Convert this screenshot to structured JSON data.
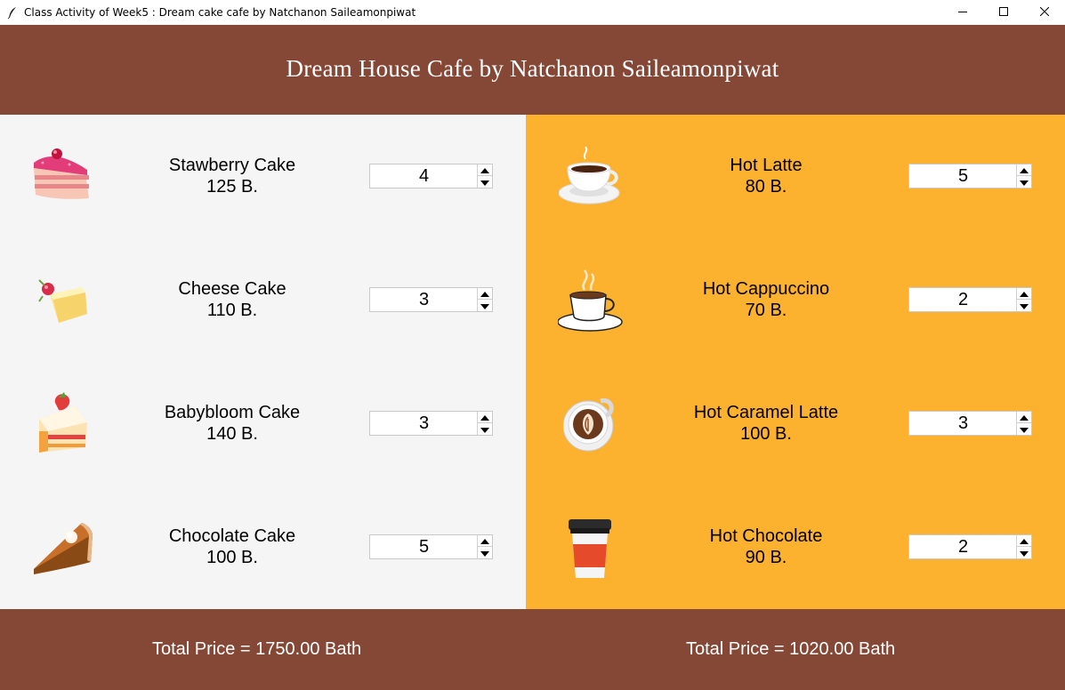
{
  "window": {
    "title": "Class Activity of Week5 : Dream cake cafe by Natchanon Saileamonpiwat",
    "icon": "feather-icon",
    "controls": [
      "minimize-icon",
      "maximize-icon",
      "close-icon"
    ]
  },
  "header": {
    "title": "Dream House Cafe by Natchanon Saileamonpiwat"
  },
  "colors": {
    "header_bg": "#864836",
    "left_panel_bg": "#f5f5f5",
    "right_panel_bg": "#fdb22f",
    "footer_bg": "#864836"
  },
  "cakes": [
    {
      "name": "Stawberry Cake",
      "price": "125 B.",
      "qty": "4",
      "icon": "strawberry-cake-icon"
    },
    {
      "name": "Cheese Cake",
      "price": "110 B.",
      "qty": "3",
      "icon": "cheese-cake-icon"
    },
    {
      "name": "Babybloom Cake",
      "price": "140 B.",
      "qty": "3",
      "icon": "babybloom-cake-icon"
    },
    {
      "name": "Chocolate Cake",
      "price": "100 B.",
      "qty": "5",
      "icon": "chocolate-pie-icon"
    }
  ],
  "drinks": [
    {
      "name": "Hot Latte",
      "price": "80 B.",
      "qty": "5",
      "icon": "coffee-cup-icon"
    },
    {
      "name": "Hot Cappuccino",
      "price": "70 B.",
      "qty": "2",
      "icon": "cappuccino-icon"
    },
    {
      "name": "Hot Caramel Latte",
      "price": "100 B.",
      "qty": "3",
      "icon": "latte-art-icon"
    },
    {
      "name": "Hot Chocolate",
      "price": "90 B.",
      "qty": "2",
      "icon": "takeaway-cup-icon"
    }
  ],
  "footer": {
    "cake_total": "Total Price = 1750.00 Bath",
    "drink_total": "Total Price = 1020.00 Bath"
  }
}
